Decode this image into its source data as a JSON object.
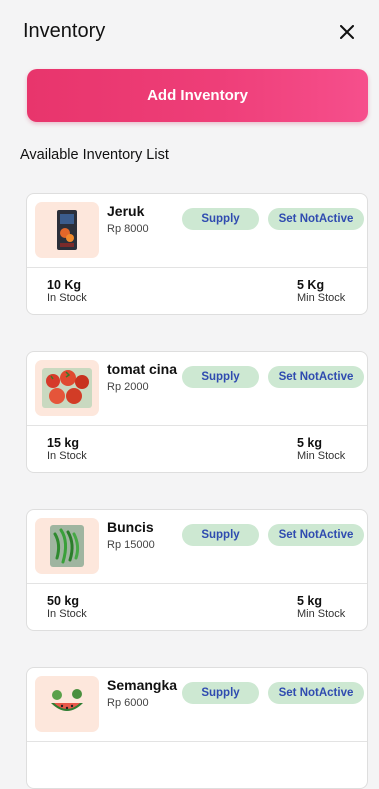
{
  "header": {
    "title": "Inventory",
    "close_icon": "close-icon"
  },
  "actions": {
    "add_label": "Add Inventory",
    "accent_color": "#ee3e78"
  },
  "section": {
    "label": "Available Inventory List"
  },
  "labels": {
    "supply": "Supply",
    "set_not_active": "Set NotActive",
    "in_stock": "In Stock",
    "min_stock": "Min Stock"
  },
  "items": [
    {
      "name": "Jeruk",
      "price": "Rp 8000",
      "stock": "10 Kg",
      "min_stock": "5 Kg",
      "image": "orange-product-image"
    },
    {
      "name": "tomat cina",
      "price": "Rp 2000",
      "stock": "15 kg",
      "min_stock": "5 kg",
      "image": "tomato-image"
    },
    {
      "name": "Buncis",
      "price": "Rp 15000",
      "stock": "50 kg",
      "min_stock": "5 kg",
      "image": "green-beans-image"
    },
    {
      "name": "Semangka",
      "price": "Rp 6000",
      "stock": "",
      "min_stock": "",
      "image": "watermelon-image"
    }
  ]
}
